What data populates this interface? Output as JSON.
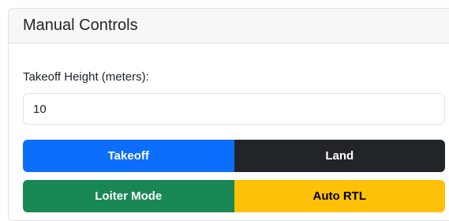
{
  "panel": {
    "title": "Manual Controls"
  },
  "takeoff_height": {
    "label": "Takeoff Height (meters):",
    "value": "10"
  },
  "buttons": {
    "takeoff": "Takeoff",
    "land": "Land",
    "loiter": "Loiter Mode",
    "auto_rtl": "Auto RTL"
  },
  "colors": {
    "takeoff": "#0d6efd",
    "land": "#212529",
    "loiter": "#198754",
    "auto_rtl": "#ffc107"
  }
}
